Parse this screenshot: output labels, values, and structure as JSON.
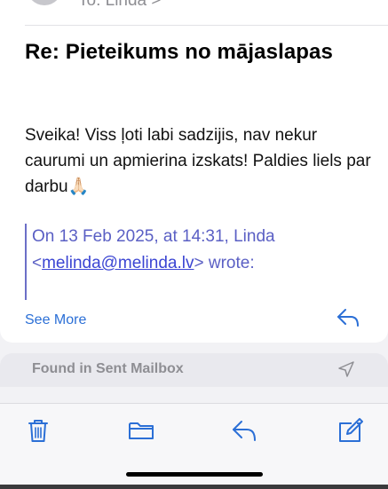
{
  "header": {
    "to_line": "To: Linda >"
  },
  "message": {
    "subject": "Re: Pieteikums no mājaslapas",
    "body": "Sveika! Viss ļoti labi sadzijis, nav nekur caurumi un apmierina izskats! Paldies liels par darbu🙏🏻",
    "quote_prefix": "On 13 Feb 2025, at 14:31, Linda <",
    "quote_email": "melinda@melinda.lv",
    "quote_suffix": "> wrote:",
    "see_more": "See More"
  },
  "found_bar": {
    "label": "Found in Sent Mailbox"
  },
  "toolbar": {
    "items": [
      "trash-icon",
      "folder-icon",
      "reply-icon",
      "compose-icon"
    ]
  },
  "colors": {
    "accent": "#2b6fd6",
    "quote": "#5a5fc4",
    "background": "#f2f2f5"
  }
}
